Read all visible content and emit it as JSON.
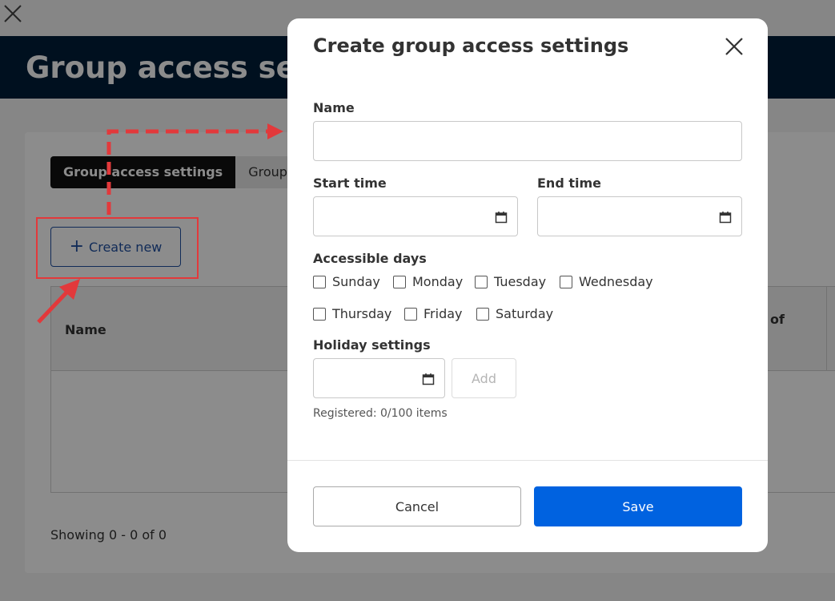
{
  "background": {
    "page_title": "Group access settings",
    "tabs": [
      {
        "label": "Group access settings",
        "active": true
      },
      {
        "label": "Group",
        "active": false
      }
    ],
    "create_button": {
      "icon": "plus-icon",
      "label": "Create new"
    },
    "table": {
      "columns": [
        "Name",
        "of"
      ]
    },
    "pagination_text": "Showing 0 - 0 of 0"
  },
  "annotation_color": "#e2393b",
  "modal": {
    "title": "Create group access settings",
    "close_icon": "close-icon",
    "name_label": "Name",
    "name_value": "",
    "start_time_label": "Start time",
    "end_time_label": "End time",
    "accessible_days_label": "Accessible days",
    "days": [
      "Sunday",
      "Monday",
      "Tuesday",
      "Wednesday",
      "Thursday",
      "Friday",
      "Saturday"
    ],
    "holiday_label": "Holiday settings",
    "add_label": "Add",
    "registered_text": "Registered: 0/100 items",
    "cancel_label": "Cancel",
    "save_label": "Save",
    "save_color": "#0062e0"
  }
}
